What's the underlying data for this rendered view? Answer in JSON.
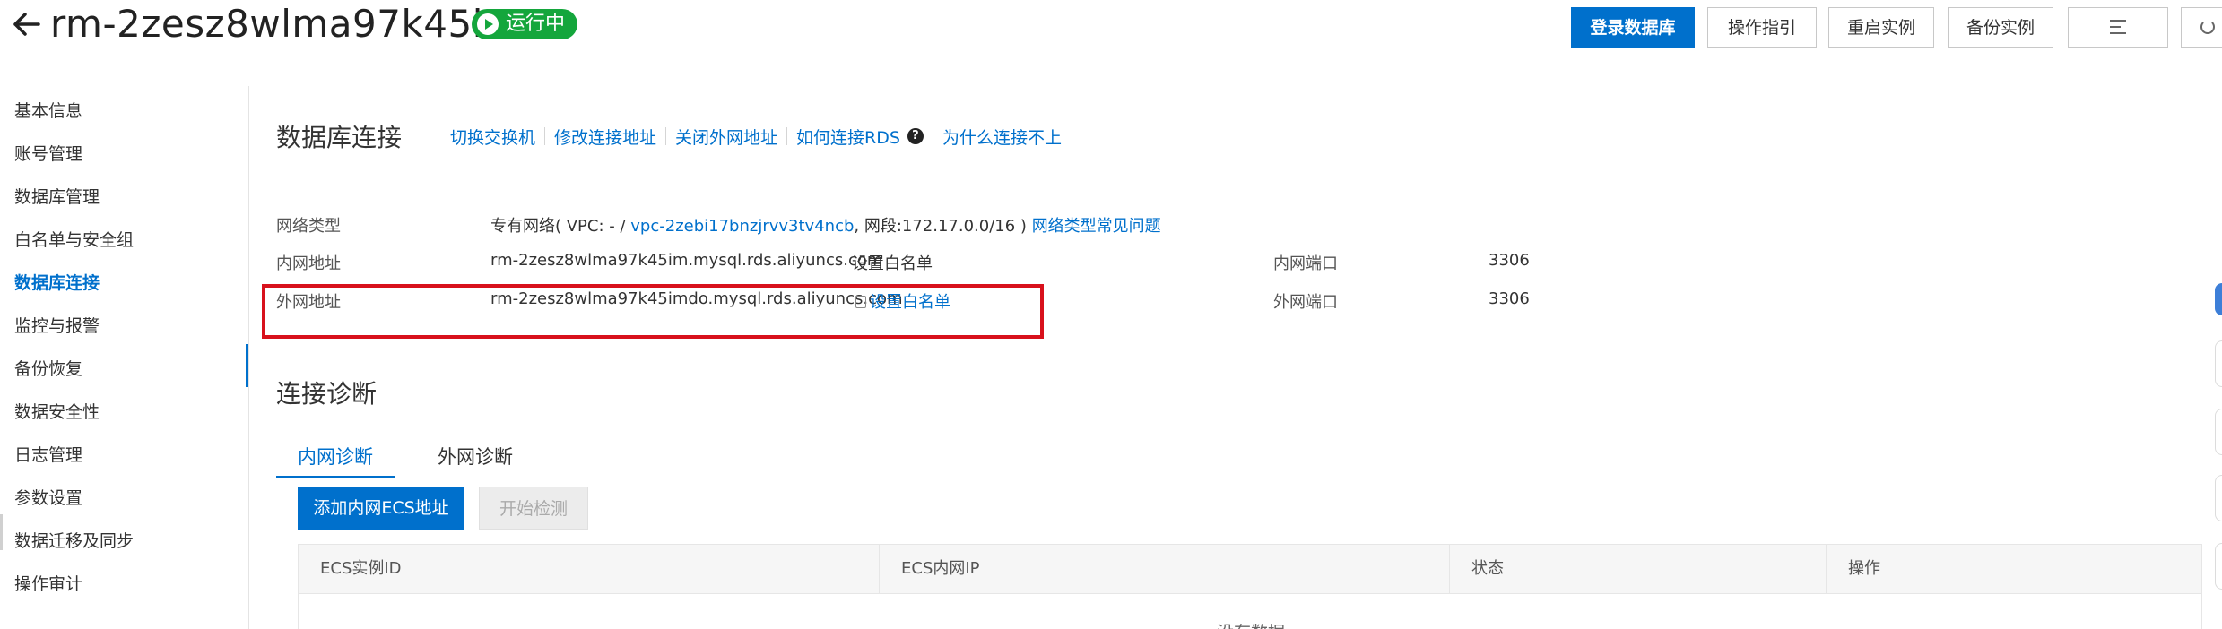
{
  "header": {
    "instance_id": "rm-2zesz8wlma97k45im",
    "status": "运行中",
    "buttons": {
      "login_db": "登录数据库",
      "guide": "操作指引",
      "restart": "重启实例",
      "backup": "备份实例"
    }
  },
  "sidebar": {
    "items": [
      {
        "label": "基本信息"
      },
      {
        "label": "账号管理"
      },
      {
        "label": "数据库管理"
      },
      {
        "label": "白名单与安全组"
      },
      {
        "label": "数据库连接"
      },
      {
        "label": "监控与报警"
      },
      {
        "label": "备份恢复"
      },
      {
        "label": "数据安全性"
      },
      {
        "label": "日志管理"
      },
      {
        "label": "参数设置"
      },
      {
        "label": "数据迁移及同步"
      },
      {
        "label": "操作审计"
      }
    ],
    "active_index": 4
  },
  "connection": {
    "title": "数据库连接",
    "links": {
      "switch_vswitch": "切换交换机",
      "modify_address": "修改连接地址",
      "close_public": "关闭外网地址",
      "how_to_connect": "如何连接RDS",
      "why_cannot_connect": "为什么连接不上"
    },
    "network_type": {
      "label": "网络类型",
      "value_prefix": "专有网络( VPC: - / ",
      "vpc_link": "vpc-2zebi17bnzjrvv3tv4ncb",
      "value_suffix": ", 网段:172.17.0.0/16 )",
      "faq_link": "网络类型常见问题"
    },
    "internal": {
      "label": "内网地址",
      "address": "rm-2zesz8wlma97k45im.mysql.rds.aliyuncs.com",
      "whitelist_link": "设置白名单",
      "port_label": "内网端口",
      "port": "3306"
    },
    "public": {
      "label": "外网地址",
      "address": "rm-2zesz8wlma97k45imdo.mysql.rds.aliyuncs.com",
      "whitelist_link": "设置白名单",
      "port_label": "外网端口",
      "port": "3306"
    }
  },
  "diagnosis": {
    "title": "连接诊断",
    "tabs": [
      "内网诊断",
      "外网诊断"
    ],
    "active_tab": 0,
    "add_button": "添加内网ECS地址",
    "start_button": "开始检测",
    "columns": [
      "ECS实例ID",
      "ECS内网IP",
      "状态",
      "操作"
    ],
    "empty_text": "没有数据"
  },
  "colors": {
    "primary": "#0070cc",
    "status_green": "#14a63c",
    "highlight_red": "#d8111c"
  }
}
